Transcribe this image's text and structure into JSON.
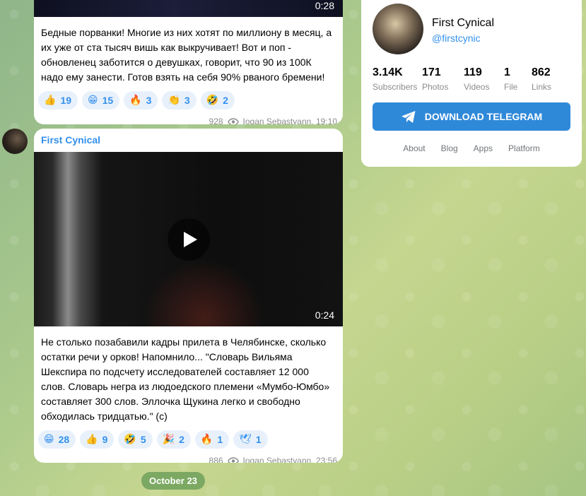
{
  "posts": [
    {
      "video_duration": "0:28",
      "text": "Бедные порванки! Многие из них хотят по миллиону в месяц, а их уже от ста тысяч вишь как выкручивает! Вот и поп - обновленец заботится о девушках, говорит, что 90 из 100К надо ему занести. Готов взять на себя 90% рваного бремени!",
      "reactions": [
        {
          "emoji": "👍",
          "count": "19"
        },
        {
          "emoji": "😁",
          "count": "15"
        },
        {
          "emoji": "🔥",
          "count": "3"
        },
        {
          "emoji": "👏",
          "count": "3"
        },
        {
          "emoji": "🤣",
          "count": "2"
        }
      ],
      "views": "928",
      "signature": "Iogan Sebastyann, 19:10"
    },
    {
      "author": "First Cynical",
      "video_duration": "0:24",
      "text": "Не столько позабавили кадры прилета в Челябинске, сколько остатки речи у орков! Напомнило... \"Словарь Вильяма Шекспира по подсчету исследователей составляет 12 000 слов. Словарь негра из людоедского племени «Мумбо-Юмбо» составляет 300 слов. Эллочка Щукина легко и свободно обходилась тридцатью.\" (с)",
      "reactions": [
        {
          "emoji": "😁",
          "count": "28"
        },
        {
          "emoji": "👍",
          "count": "9"
        },
        {
          "emoji": "🤣",
          "count": "5"
        },
        {
          "emoji": "🎉",
          "count": "2"
        },
        {
          "emoji": "🔥",
          "count": "1"
        },
        {
          "emoji": "🕊",
          "count": "1"
        }
      ],
      "views": "886",
      "signature": "Iogan Sebastyann, 23:56"
    }
  ],
  "date_separator": "October 23",
  "channel": {
    "name": "First Cynical",
    "username": "@firstcynic",
    "stats": [
      {
        "value": "3.14K",
        "label": "Subscribers"
      },
      {
        "value": "171",
        "label": "Photos"
      },
      {
        "value": "119",
        "label": "Videos"
      },
      {
        "value": "1",
        "label": "File"
      },
      {
        "value": "862",
        "label": "Links"
      }
    ],
    "download_label": "DOWNLOAD TELEGRAM",
    "links": [
      "About",
      "Blog",
      "Apps",
      "Platform"
    ]
  },
  "colors": {
    "accent": "#3390ec",
    "button": "#2f89d9"
  }
}
